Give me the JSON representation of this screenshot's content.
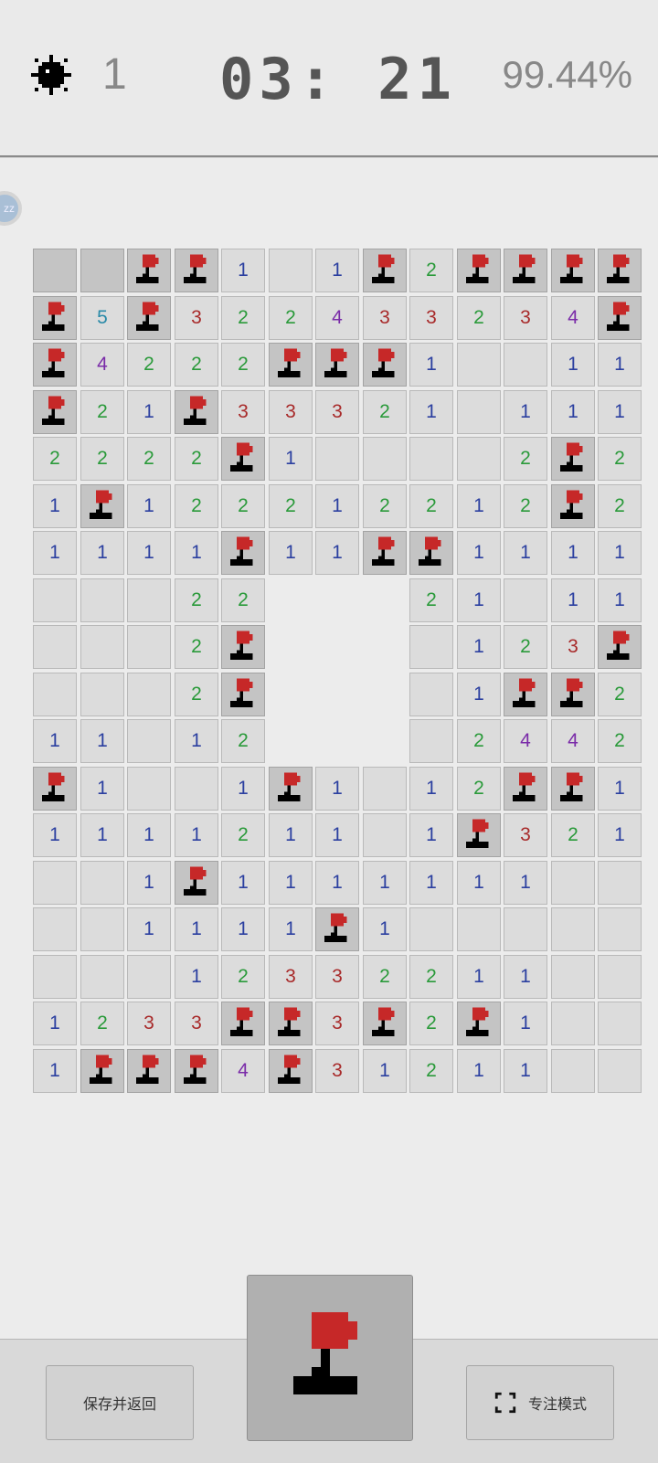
{
  "header": {
    "mines_remaining": "1",
    "timer": "03: 21",
    "progress": "99.44%",
    "mine_icon": "mine-icon"
  },
  "side_badge": {
    "label": "zz"
  },
  "board": {
    "cols": 13,
    "rows": 18,
    "legend": "F = flag, # = covered, . = revealed empty, number = adjacent mines",
    "grid": [
      [
        "#",
        "#",
        "F",
        "F",
        "1",
        ".",
        "1",
        "F",
        "2",
        "F",
        "F",
        "F",
        "F"
      ],
      [
        "F",
        "5",
        "F",
        "3",
        "2",
        "2",
        "4",
        "3",
        "3",
        "2",
        "3",
        "4",
        "F"
      ],
      [
        "F",
        "4",
        "2",
        "2",
        "2",
        "F",
        "F",
        "F",
        "1",
        ".",
        ".",
        "1",
        "1"
      ],
      [
        "F",
        "2",
        "1",
        "F",
        "3",
        "3",
        "3",
        "2",
        "1",
        ".",
        "1",
        "1",
        "1"
      ],
      [
        "2",
        "2",
        "2",
        "2",
        "F",
        "1",
        ".",
        ".",
        ".",
        ".",
        "2",
        "F",
        "2"
      ],
      [
        "1",
        "F",
        "1",
        "2",
        "2",
        "2",
        "1",
        "2",
        "2",
        "1",
        "2",
        "F",
        "2"
      ],
      [
        "1",
        "1",
        "1",
        "1",
        "F",
        "1",
        "1",
        "F",
        "F",
        "1",
        "1",
        "1",
        "1"
      ],
      [
        ".",
        ".",
        ".",
        "2",
        "2",
        "o",
        "o",
        "o",
        "2",
        "1",
        ".",
        "1",
        "1"
      ],
      [
        ".",
        ".",
        ".",
        "2",
        "F",
        "o",
        "o",
        "o",
        ".",
        "1",
        "2",
        "3",
        "F"
      ],
      [
        ".",
        ".",
        ".",
        "2",
        "F",
        "o",
        "o",
        "o",
        ".",
        "1",
        "F",
        "F",
        "2"
      ],
      [
        "1",
        "1",
        ".",
        "1",
        "2",
        "o",
        "o",
        "o",
        ".",
        "2",
        "4",
        "4",
        "2"
      ],
      [
        "F",
        "1",
        ".",
        ".",
        "1",
        "F",
        "1",
        ".",
        "1",
        "2",
        "F",
        "F",
        "1"
      ],
      [
        "1",
        "1",
        "1",
        "1",
        "2",
        "1",
        "1",
        ".",
        "1",
        "F",
        "3",
        "2",
        "1"
      ],
      [
        ".",
        ".",
        "1",
        "F",
        "1",
        "1",
        "1",
        "1",
        "1",
        "1",
        "1",
        ".",
        "."
      ],
      [
        ".",
        ".",
        "1",
        "1",
        "1",
        "1",
        "F",
        "1",
        ".",
        ".",
        ".",
        ".",
        "."
      ],
      [
        ".",
        ".",
        ".",
        "1",
        "2",
        "3",
        "3",
        "2",
        "2",
        "1",
        "1",
        ".",
        "."
      ],
      [
        "1",
        "2",
        "3",
        "3",
        "F",
        "F",
        "3",
        "F",
        "2",
        "F",
        "1",
        ".",
        "."
      ],
      [
        "1",
        "F",
        "F",
        "F",
        "4",
        "F",
        "3",
        "1",
        "2",
        "1",
        "1",
        ".",
        "."
      ]
    ],
    "number_colors": {
      "1": "#2b3fa0",
      "2": "#2a9a3a",
      "3": "#a82a2a",
      "4": "#7a2ba8",
      "5": "#2a8aa8"
    }
  },
  "bottom": {
    "save_label": "保存并返回",
    "focus_label": "专注模式",
    "flag_mode_icon": "flag-icon",
    "focus_icon": "fullscreen-icon"
  }
}
